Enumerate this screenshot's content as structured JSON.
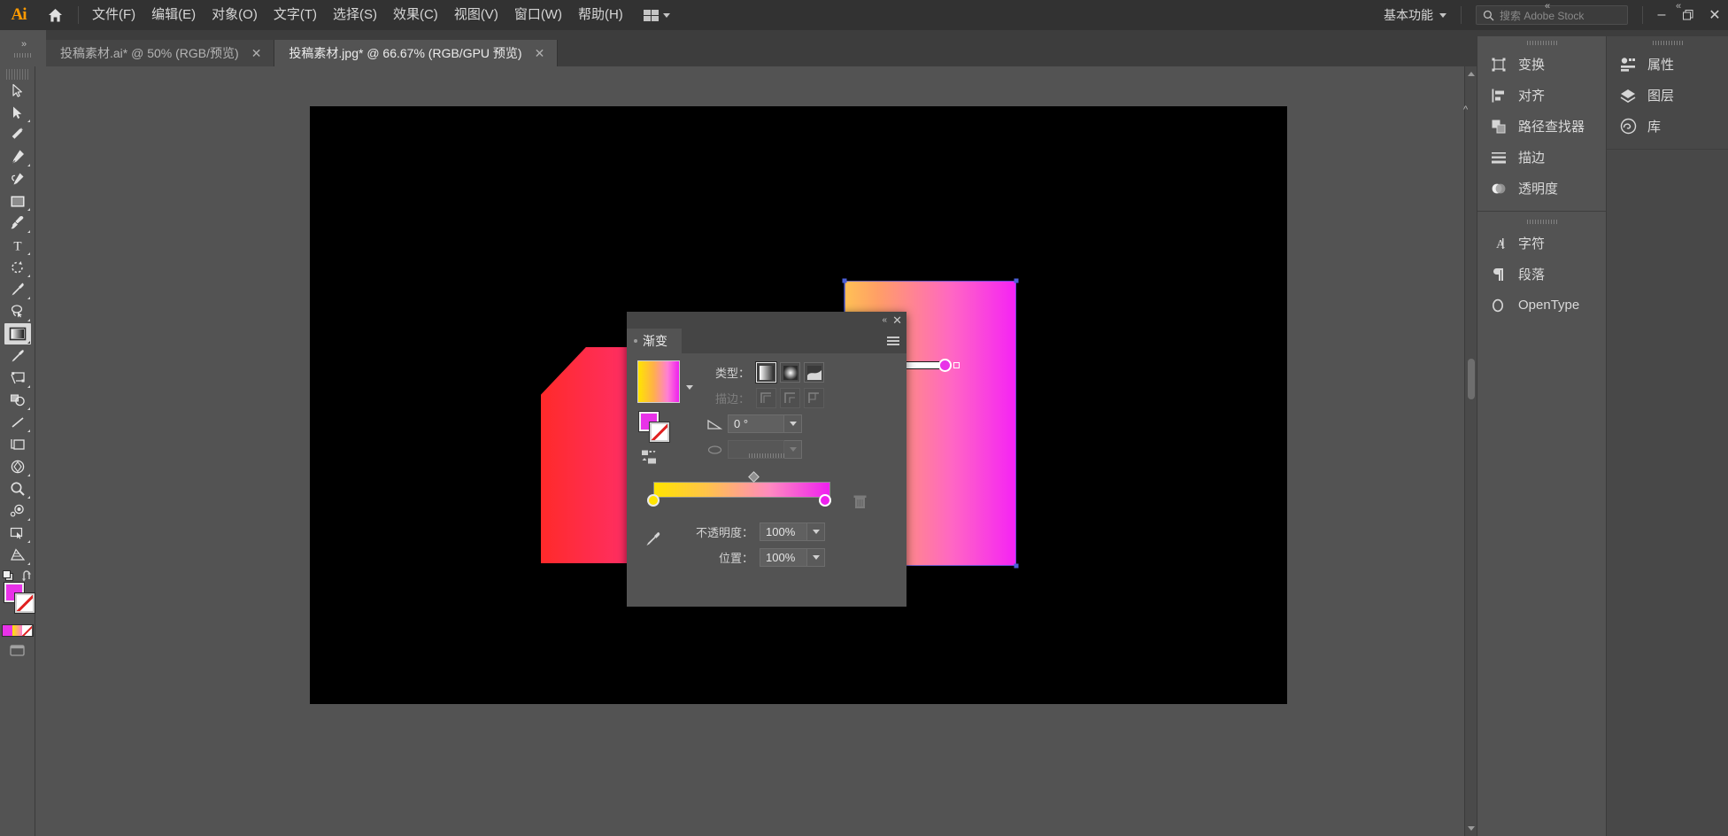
{
  "app": {
    "logo_text": "Ai",
    "home_icon": "home-icon"
  },
  "menubar": {
    "items": [
      {
        "label": "文件(F)"
      },
      {
        "label": "编辑(E)"
      },
      {
        "label": "对象(O)"
      },
      {
        "label": "文字(T)"
      },
      {
        "label": "选择(S)"
      },
      {
        "label": "效果(C)"
      },
      {
        "label": "视图(V)"
      },
      {
        "label": "窗口(W)"
      },
      {
        "label": "帮助(H)"
      }
    ],
    "workspace": "基本功能",
    "search_placeholder": "搜索 Adobe Stock",
    "window_buttons": {
      "minimize": "–",
      "restore": "❐",
      "close": "✕"
    }
  },
  "tabs": [
    {
      "title": "投稿素材.ai* @ 50% (RGB/预览)",
      "active": false,
      "close": "✕"
    },
    {
      "title": "投稿素材.jpg* @ 66.67% (RGB/GPU 预览)",
      "active": true,
      "close": "✕"
    }
  ],
  "toolbar": {
    "tools": [
      {
        "name": "selection-tool",
        "active": false
      },
      {
        "name": "direct-selection-tool",
        "active": false
      },
      {
        "name": "magic-wand-tool",
        "active": false
      },
      {
        "name": "pen-tool",
        "active": false
      },
      {
        "name": "curvature-tool",
        "active": false
      },
      {
        "name": "rectangle-tool",
        "active": false
      },
      {
        "name": "paintbrush-tool",
        "active": false
      },
      {
        "name": "type-tool",
        "active": false
      },
      {
        "name": "rotate-tool",
        "active": false
      },
      {
        "name": "eyedropper-tool",
        "active": false
      },
      {
        "name": "lasso-tool",
        "active": false
      },
      {
        "name": "gradient-tool",
        "active": true
      },
      {
        "name": "blob-brush-tool",
        "active": false
      },
      {
        "name": "free-transform-tool",
        "active": false
      },
      {
        "name": "shape-builder-tool",
        "active": false
      },
      {
        "name": "line-segment-tool",
        "active": false
      },
      {
        "name": "artboard-tool",
        "active": false
      },
      {
        "name": "perspective-grid-tool",
        "active": false
      },
      {
        "name": "zoom-tool",
        "active": false
      },
      {
        "name": "blend-tool",
        "active": false
      },
      {
        "name": "slice-tool",
        "active": false
      },
      {
        "name": "mesh-tool",
        "active": false
      }
    ],
    "fill_color": "#e832e8",
    "stroke_color": "none",
    "modes": [
      "color-mode",
      "gradient-mode",
      "none-mode"
    ]
  },
  "canvas": {
    "background": "#000000",
    "shapes": [
      {
        "name": "red-pink-chamfered-shape",
        "gradient_from": "#ff2a2a",
        "gradient_to": "#ff2391"
      },
      {
        "name": "green-triangle-shape",
        "color": "#00e832"
      },
      {
        "name": "yellow-magenta-j-shape",
        "gradient_from": "#ffd24d",
        "gradient_to": "#f522f5",
        "selected": true
      }
    ],
    "annotator": {
      "name": "gradient-annotator",
      "start_color": "#ffd900",
      "end_color": "#e832e8"
    }
  },
  "gradient_panel": {
    "tab_title": "渐变",
    "close": "✕",
    "collapse": "«",
    "type_label": "类型：",
    "type_options": [
      "linear-gradient",
      "radial-gradient",
      "freeform-gradient"
    ],
    "type_selected": "linear-gradient",
    "stroke_label": "描边：",
    "stroke_options": [
      "stroke-within",
      "stroke-center",
      "stroke-outside"
    ],
    "angle_value": "0 °",
    "aspect_value": "",
    "opacity_label": "不透明度：",
    "opacity_value": "100%",
    "location_label": "位置：",
    "location_value": "100%",
    "stops": [
      {
        "position": 0,
        "color": "#ffe400"
      },
      {
        "position": 100,
        "color": "#ef20ef"
      }
    ],
    "midpoint": 54
  },
  "docks": {
    "left_group": [
      {
        "label": "变换",
        "icon": "transform-icon"
      },
      {
        "label": "对齐",
        "icon": "align-icon"
      },
      {
        "label": "路径查找器",
        "icon": "pathfinder-icon"
      },
      {
        "label": "描边",
        "icon": "stroke-icon"
      },
      {
        "label": "透明度",
        "icon": "transparency-icon"
      }
    ],
    "left_group2": [
      {
        "label": "字符",
        "icon": "character-icon"
      },
      {
        "label": "段落",
        "icon": "paragraph-icon"
      },
      {
        "label": "OpenType",
        "icon": "opentype-icon"
      }
    ],
    "right_group": [
      {
        "label": "属性",
        "icon": "properties-icon"
      },
      {
        "label": "图层",
        "icon": "layers-icon"
      },
      {
        "label": "库",
        "icon": "libraries-icon"
      }
    ]
  }
}
